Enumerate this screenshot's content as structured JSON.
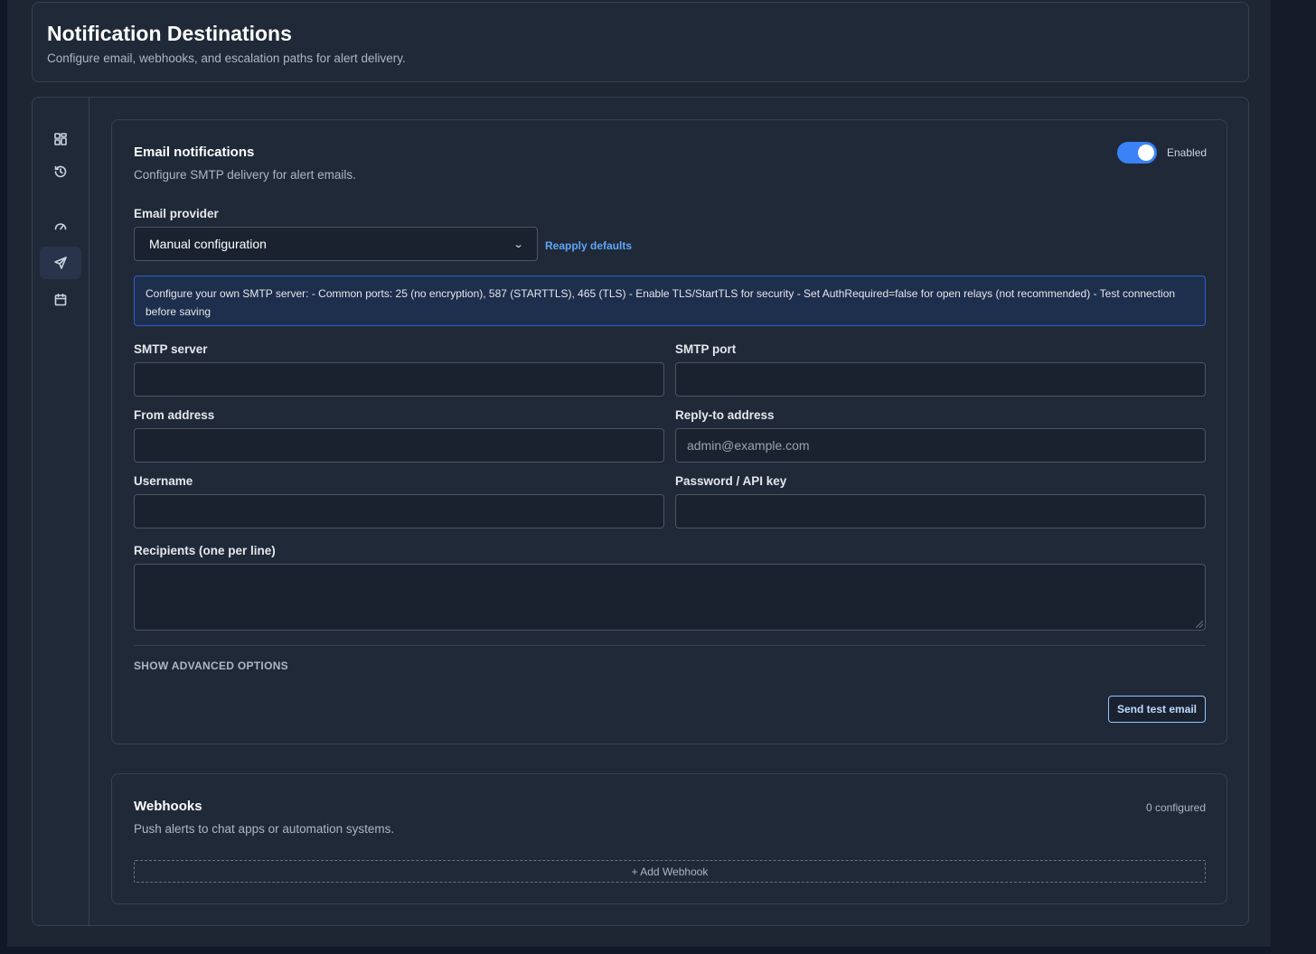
{
  "page": {
    "title": "Notification Destinations",
    "subtitle": "Configure email, webhooks, and escalation paths for alert delivery."
  },
  "rail": {
    "items": [
      {
        "icon": "grid-icon",
        "active": false
      },
      {
        "icon": "history-icon",
        "active": false
      },
      {
        "icon": "gauge-icon",
        "active": false
      },
      {
        "icon": "send-icon",
        "active": true
      },
      {
        "icon": "calendar-icon",
        "active": false
      }
    ]
  },
  "email": {
    "title": "Email notifications",
    "description": "Configure SMTP delivery for alert emails.",
    "toggle_label": "Enabled",
    "toggle_on": true,
    "provider_label": "Email provider",
    "provider_value": "Manual configuration",
    "reapply_label": "Reapply defaults",
    "info_text": "Configure your own SMTP server: - Common ports: 25 (no encryption), 587 (STARTTLS), 465 (TLS) - Enable TLS/StartTLS for security - Set AuthRequired=false for open relays (not recommended) - Test connection before saving",
    "smtp_server_label": "SMTP server",
    "smtp_server_value": "",
    "smtp_port_label": "SMTP port",
    "smtp_port_value": "",
    "from_label": "From address",
    "from_value": "",
    "reply_to_label": "Reply-to address",
    "reply_to_placeholder": "admin@example.com",
    "username_label": "Username",
    "username_value": "",
    "password_label": "Password / API key",
    "password_value": "",
    "recipients_label": "Recipients (one per line)",
    "recipients_value": "",
    "advanced_label": "SHOW ADVANCED OPTIONS",
    "test_button_label": "Send test email"
  },
  "webhooks": {
    "title": "Webhooks",
    "description": "Push alerts to chat apps or automation systems.",
    "count_label": "0 configured",
    "add_label": "+ Add Webhook"
  },
  "colors": {
    "accent": "#3b82f6",
    "link": "#60a5fa",
    "info_bg": "#1e2e4d",
    "info_border": "#2f5dd0",
    "card_bg": "#1f2937"
  }
}
